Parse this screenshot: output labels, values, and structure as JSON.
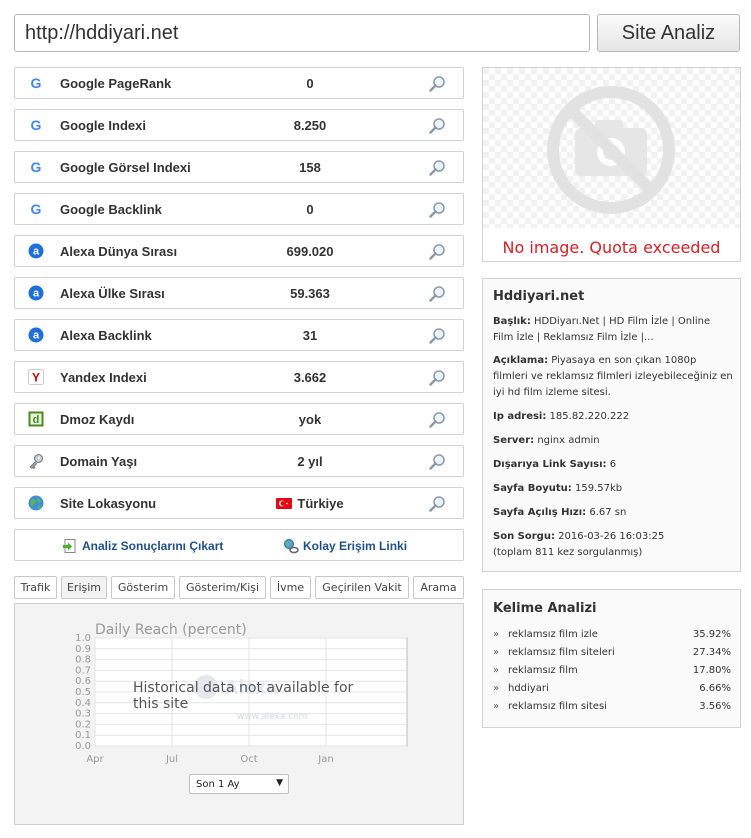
{
  "search": {
    "value": "http://hddiyari.net"
  },
  "analyze_button": {
    "label": "Site Analiz"
  },
  "metrics": [
    {
      "label": "Google PageRank",
      "value": "0",
      "icon": "google-icon"
    },
    {
      "label": "Google Indexi",
      "value": "8.250",
      "icon": "google-icon"
    },
    {
      "label": "Google Görsel Indexi",
      "value": "158",
      "icon": "google-icon"
    },
    {
      "label": "Google Backlink",
      "value": "0",
      "icon": "google-icon"
    },
    {
      "label": "Alexa Dünya Sırası",
      "value": "699.020",
      "icon": "alexa-icon"
    },
    {
      "label": "Alexa Ülke Sırası",
      "value": "59.363",
      "icon": "alexa-icon"
    },
    {
      "label": "Alexa Backlink",
      "value": "31",
      "icon": "alexa-icon"
    },
    {
      "label": "Yandex Indexi",
      "value": "3.662",
      "icon": "yandex-icon"
    },
    {
      "label": "Dmoz Kaydı",
      "value": "yok",
      "icon": "dmoz-icon"
    },
    {
      "label": "Domain Yaşı",
      "value": "2 yıl",
      "icon": "key-icon"
    },
    {
      "label": "Site Lokasyonu",
      "value": "Türkiye",
      "icon": "globe-icon"
    }
  ],
  "actions": {
    "export": "Analiz Sonuçlarını Çıkart",
    "easy_link": "Kolay Erişim Linki"
  },
  "tabs": [
    "Trafik",
    "Erişim",
    "Gösterim",
    "Gösterim/Kişi",
    "İvme",
    "Geçirilen Vakit",
    "Arama"
  ],
  "active_tab": "Erişim",
  "traffic_chart": {
    "title": "Daily Reach (percent)",
    "message": "Historical data not available for this site",
    "watermark": "Alexa",
    "watermark_url": "www.alexa.com",
    "range_select": "Son 1 Ay"
  },
  "chart_data": {
    "type": "line",
    "title": "Daily Reach (percent)",
    "ylim": [
      0.0,
      1.0
    ],
    "y_ticks": [
      "1.0",
      "0.9",
      "0.8",
      "0.7",
      "0.6",
      "0.5",
      "0.4",
      "0.3",
      "0.2",
      "0.1",
      "0.0"
    ],
    "x_ticks": [
      "Apr",
      "Jul",
      "Oct",
      "Jan"
    ],
    "series": [],
    "grid": true,
    "annotation": "Historical data not available for this site"
  },
  "thumbnail": {
    "message": "No image. Quota exceeded"
  },
  "site_info": {
    "title": "Hddiyari.net",
    "title_label": "Başlık:",
    "title_value": "HDDiyarı.Net | HD Film İzle | Online Film İzle | Reklamsız Film İzle |...",
    "description_label": "Açıklama:",
    "description_value": "Piyasaya en son çıkan 1080p filmleri ve reklamsız filmleri izleyebileceğiniz en iyi hd film izleme sitesi.",
    "ip_label": "Ip adresi:",
    "ip_value": "185.82.220.222",
    "server_label": "Server:",
    "server_value": "nginx admin",
    "outlinks_label": "Dışarıya Link Sayısı:",
    "outlinks_value": "6",
    "page_size_label": "Sayfa Boyutu:",
    "page_size_value": "159.57kb",
    "load_speed_label": "Sayfa Açılış Hızı:",
    "load_speed_value": "6.67 sn",
    "last_query_label": "Son Sorgu:",
    "last_query_value": "2016-03-26 16:03:25",
    "query_count": "(toplam 811 kez sorgulanmış)"
  },
  "keyword_analysis": {
    "title": "Kelime Analizi",
    "bullet": "»",
    "items": [
      {
        "keyword": "reklamsız film izle",
        "percent": "35.92%"
      },
      {
        "keyword": "reklamsız film siteleri",
        "percent": "27.34%"
      },
      {
        "keyword": "reklamsız film",
        "percent": "17.80%"
      },
      {
        "keyword": "hddiyari",
        "percent": "6.66%"
      },
      {
        "keyword": "reklamsız film sitesi",
        "percent": "3.56%"
      }
    ]
  },
  "colors": {
    "link": "#20508a",
    "quota_red": "#d81f26",
    "alexa_blue": "#1e6fd9",
    "yandex_red": "#d00000",
    "dmoz_green": "#4a8a1e",
    "flag_red": "#e30a17"
  }
}
